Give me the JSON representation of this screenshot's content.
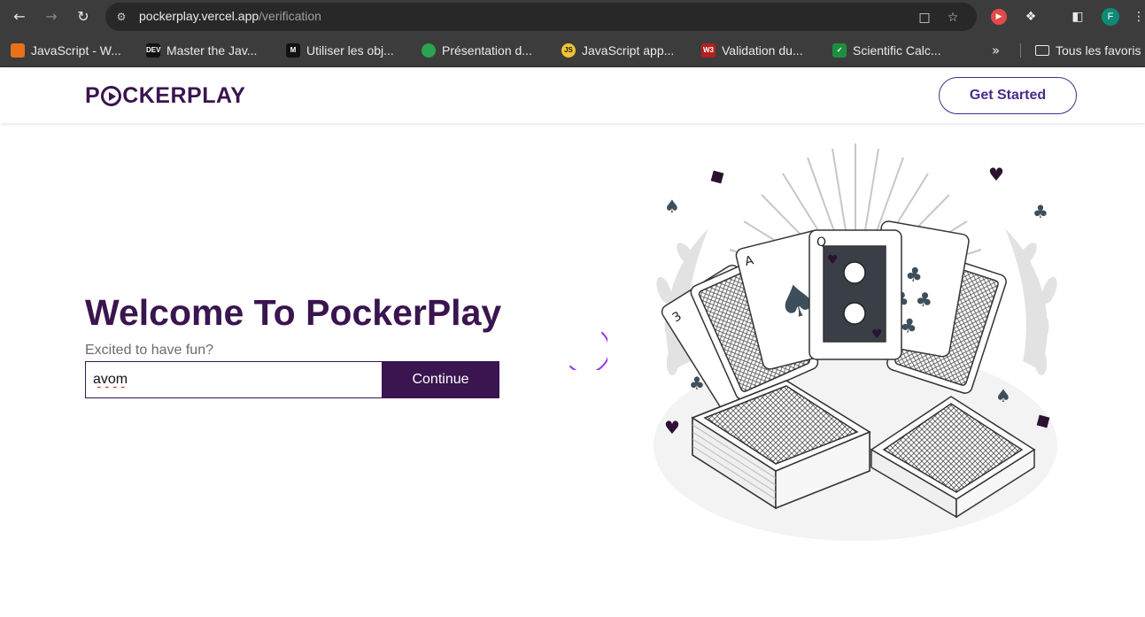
{
  "browser": {
    "url_host": "pockerplay.vercel.app",
    "url_path": "/verification",
    "profile_initial": "F",
    "bookmarks": [
      {
        "label": "JavaScript - W...",
        "icon": "fox-icon",
        "color": "#e8711a"
      },
      {
        "label": "Master the Jav...",
        "icon": "dev-icon",
        "color": "#111111"
      },
      {
        "label": "Utiliser les obj...",
        "icon": "mdn-icon",
        "color": "#111111"
      },
      {
        "label": "Présentation d...",
        "icon": "globe-icon",
        "color": "#2aa44f"
      },
      {
        "label": "JavaScript app...",
        "icon": "js-icon",
        "color": "#f0c330"
      },
      {
        "label": "Validation du...",
        "icon": "w3-icon",
        "color": "#b32020"
      },
      {
        "label": "Scientific Calc...",
        "icon": "check-icon",
        "color": "#1e8e3e"
      }
    ],
    "bookmarks_folder": "Tous les favoris"
  },
  "header": {
    "logo_prefix": "P",
    "logo_suffix": "CKERPLAY",
    "get_started": "Get Started"
  },
  "main": {
    "title": "Welcome To PockerPlay",
    "subtitle": "Excited to have fun?",
    "input_value": "avom",
    "continue_label": "Continue"
  },
  "colors": {
    "brand": "#3a1550",
    "accent": "#4b2a8c",
    "spinner": "#8a2be2"
  }
}
